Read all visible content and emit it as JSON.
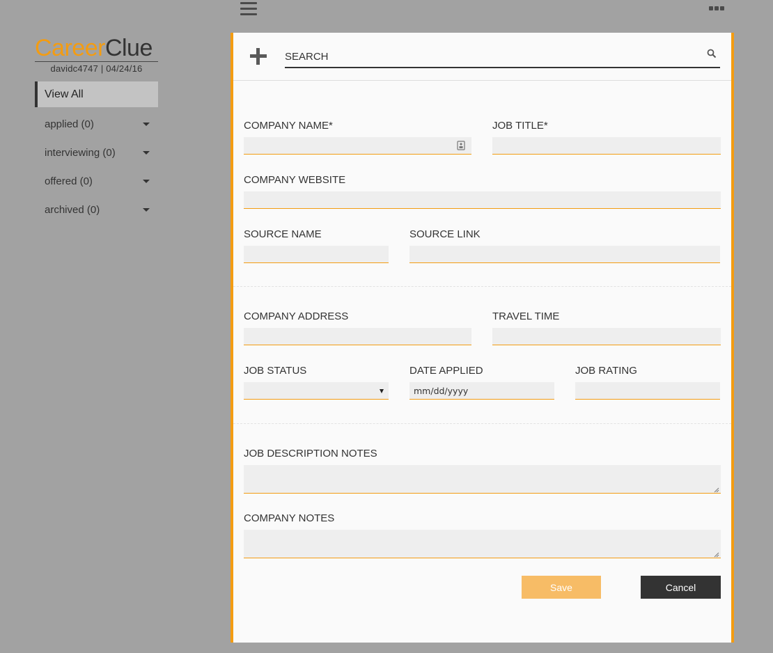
{
  "topbar": {
    "menu_icon": "hamburger-menu-icon",
    "more_icon": "more-dots-icon"
  },
  "brand": {
    "name_part1": "Career",
    "name_part2": "Clue",
    "user_line": "davidc4747 | 04/24/16"
  },
  "sidebar": {
    "items": [
      {
        "label": "View All",
        "active": true
      },
      {
        "label": "applied (0)",
        "caret": "caret-down-icon"
      },
      {
        "label": "interviewing (0)",
        "caret": "caret-down-icon"
      },
      {
        "label": "offered (0)",
        "caret": "caret-down-icon"
      },
      {
        "label": "archived (0)",
        "caret": "caret-down-icon"
      }
    ]
  },
  "search": {
    "placeholder": "SEARCH",
    "value": "",
    "icon": "search-icon",
    "add_icon": "plus-icon"
  },
  "form": {
    "company_name": {
      "label": "COMPANY NAME*",
      "value": ""
    },
    "job_title": {
      "label": "JOB TITLE*",
      "value": ""
    },
    "company_website": {
      "label": "COMPANY WEBSITE",
      "value": ""
    },
    "source_name": {
      "label": "SOURCE NAME",
      "value": ""
    },
    "source_link": {
      "label": "SOURCE LINK",
      "value": ""
    },
    "company_address": {
      "label": "COMPANY ADDRESS",
      "value": ""
    },
    "travel_time": {
      "label": "TRAVEL TIME",
      "value": ""
    },
    "job_status": {
      "label": "JOB STATUS",
      "value": ""
    },
    "date_applied": {
      "label": "DATE APPLIED",
      "placeholder": "mm/dd/yyyy"
    },
    "job_rating": {
      "label": "JOB RATING",
      "value": ""
    },
    "job_description_notes": {
      "label": "JOB DESCRIPTION NOTES",
      "value": ""
    },
    "company_notes": {
      "label": "COMPANY NOTES",
      "value": ""
    }
  },
  "buttons": {
    "save": "Save",
    "cancel": "Cancel"
  },
  "colors": {
    "accent": "#f39c12",
    "save_bg": "#f7bc66",
    "cancel_bg": "#333333",
    "background": "#a2a2a2",
    "panel": "#fafafa"
  }
}
